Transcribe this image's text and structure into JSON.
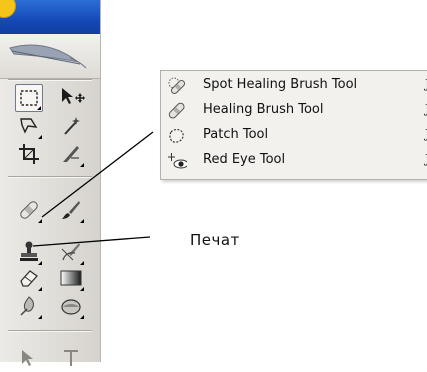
{
  "flyout_menu": {
    "items": [
      {
        "label": "Spot Healing Brush Tool",
        "shortcut": "J",
        "icon": "spot-healing-brush-icon"
      },
      {
        "label": "Healing Brush Tool",
        "shortcut": "J",
        "icon": "healing-brush-icon"
      },
      {
        "label": "Patch Tool",
        "shortcut": "J",
        "icon": "patch-icon"
      },
      {
        "label": "Red Eye Tool",
        "shortcut": "J",
        "icon": "red-eye-icon"
      }
    ]
  },
  "callout": {
    "label": "Печат"
  },
  "toolbox": {
    "tools": [
      {
        "icon": "rectangular-marquee-icon",
        "selected": true
      },
      {
        "icon": "move-icon"
      },
      {
        "icon": "lasso-icon"
      },
      {
        "icon": "magic-wand-icon"
      },
      {
        "icon": "crop-icon"
      },
      {
        "icon": "slice-icon"
      },
      {
        "icon": "spot-healing-brush-icon"
      },
      {
        "icon": "brush-icon"
      },
      {
        "icon": "clone-stamp-icon"
      },
      {
        "icon": "history-brush-icon"
      },
      {
        "icon": "eraser-icon"
      },
      {
        "icon": "gradient-icon"
      },
      {
        "icon": "blur-icon"
      },
      {
        "icon": "dodge-icon"
      },
      {
        "icon": "path-selection-icon"
      },
      {
        "icon": "type-icon"
      }
    ]
  },
  "colors": {
    "titlebar": "#1b55c4",
    "corner_badge": "#f6c51c",
    "menu_bg": "#f2f1ee",
    "toolbox_bg": "#dcd9d3"
  }
}
